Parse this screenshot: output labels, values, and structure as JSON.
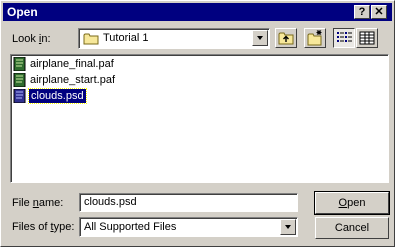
{
  "window": {
    "title": "Open"
  },
  "titlebar": {
    "help_label": "?",
    "close_label": "✕"
  },
  "look_in": {
    "label_prefix": "Look ",
    "label_accel": "i",
    "label_suffix": "n:",
    "value": "Tutorial 1"
  },
  "files": [
    {
      "name": "airplane_final.paf",
      "selected": false
    },
    {
      "name": "airplane_start.paf",
      "selected": false
    },
    {
      "name": "clouds.psd",
      "selected": true
    }
  ],
  "file_name": {
    "label_prefix": "File ",
    "label_accel": "n",
    "label_suffix": "ame:",
    "value": "clouds.psd"
  },
  "file_type": {
    "label_prefix": "Files of ",
    "label_accel": "t",
    "label_suffix": "ype:",
    "value": "All Supported Files"
  },
  "buttons": {
    "open_accel": "O",
    "open_rest": "pen",
    "cancel": "Cancel"
  },
  "colors": {
    "titlebar": "#000080",
    "face": "#d4d0c8",
    "selection": "#000080"
  },
  "icons": [
    "folder-icon",
    "up-folder-icon",
    "new-folder-icon",
    "list-view-icon",
    "details-view-icon",
    "document-icon"
  ]
}
